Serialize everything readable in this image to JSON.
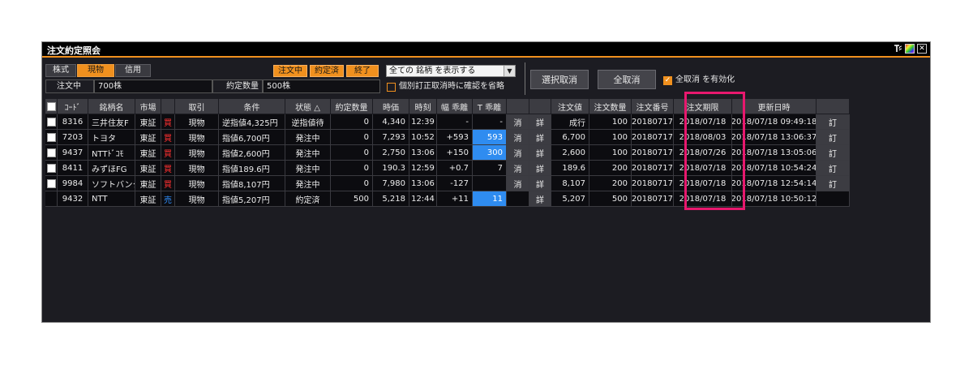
{
  "window": {
    "title": "注文約定照会",
    "icons": [
      "notification-icon",
      "color-theme-icon",
      "close-icon"
    ],
    "close_glyph": "✕"
  },
  "filters": {
    "product_tabs": [
      "株式",
      "現物",
      "信用"
    ],
    "product_selected": "現物",
    "status_chips": [
      "注文中",
      "約定済",
      "終了"
    ]
  },
  "summary": {
    "ordering_label": "注文中",
    "ordering_value": "700株",
    "executed_label": "約定数量",
    "executed_value": "500株"
  },
  "stock_filter": {
    "selected": "全ての 銘柄 を表示する"
  },
  "confirm_option": {
    "label": "個別訂正取消時に確認を省略",
    "checked": false
  },
  "actions": {
    "cancel_selected": "選択取消",
    "cancel_all": "全取消",
    "enable_cancel_all_label": "全取消 を有効化",
    "enable_cancel_all_checked": true
  },
  "table": {
    "columns": [
      "",
      "ｺｰﾄﾞ",
      "銘柄名",
      "市場",
      "",
      "取引",
      "条件",
      "状態 △",
      "約定数量",
      "時価",
      "時刻",
      "幅 乖離",
      "T 乖離",
      "",
      "",
      "注文値",
      "注文数量",
      "注文番号",
      "注文期限",
      "更新日時",
      ""
    ],
    "rows": [
      {
        "code": "8316",
        "name": "三井住友F",
        "market": "東証",
        "side": "買",
        "trade": "現物",
        "condition": "逆指値4,325円",
        "status": "逆指値待",
        "filled": "0",
        "price": "4,340",
        "time": "12:39",
        "spread": "-",
        "t_spread": "-",
        "cancel": "消",
        "detail": "詳",
        "order_price": "成行",
        "order_qty": "100",
        "order_no": "20180717",
        "expiry": "2018/07/18",
        "updated": "2018/07/18 09:49:18",
        "amend": "訂"
      },
      {
        "code": "7203",
        "name": "トヨタ",
        "market": "東証",
        "side": "買",
        "trade": "現物",
        "condition": "指値6,700円",
        "status": "発注中",
        "filled": "0",
        "price": "7,293",
        "time": "10:52",
        "spread": "+593",
        "t_spread": "593",
        "cancel": "消",
        "detail": "詳",
        "order_price": "6,700",
        "order_qty": "100",
        "order_no": "20180717",
        "expiry": "2018/08/03",
        "updated": "2018/07/18 13:06:37",
        "amend": "訂"
      },
      {
        "code": "9437",
        "name": "NTTﾄﾞｺﾓ",
        "market": "東証",
        "side": "買",
        "trade": "現物",
        "condition": "指値2,600円",
        "status": "発注中",
        "filled": "0",
        "price": "2,750",
        "time": "13:06",
        "spread": "+150",
        "t_spread": "300",
        "cancel": "消",
        "detail": "詳",
        "order_price": "2,600",
        "order_qty": "100",
        "order_no": "20180717",
        "expiry": "2018/07/26",
        "updated": "2018/07/18 13:05:06",
        "amend": "訂"
      },
      {
        "code": "8411",
        "name": "みずほFG",
        "market": "東証",
        "side": "買",
        "trade": "現物",
        "condition": "指値189.6円",
        "status": "発注中",
        "filled": "0",
        "price": "190.3",
        "time": "12:59",
        "spread": "+0.7",
        "t_spread": "7",
        "cancel": "消",
        "detail": "詳",
        "order_price": "189.6",
        "order_qty": "200",
        "order_no": "20180717",
        "expiry": "2018/07/18",
        "updated": "2018/07/18 10:54:24",
        "amend": "訂"
      },
      {
        "code": "9984",
        "name": "ソフトバンク",
        "market": "東証",
        "side": "買",
        "trade": "現物",
        "condition": "指値8,107円",
        "status": "発注中",
        "filled": "0",
        "price": "7,980",
        "time": "13:06",
        "spread": "-127",
        "t_spread": "",
        "cancel": "消",
        "detail": "詳",
        "order_price": "8,107",
        "order_qty": "200",
        "order_no": "20180717",
        "expiry": "2018/07/18",
        "updated": "2018/07/18 12:54:14",
        "amend": "訂"
      },
      {
        "code": "9432",
        "name": "NTT",
        "market": "東証",
        "side": "売",
        "trade": "現物",
        "condition": "指値5,207円",
        "status": "約定済",
        "filled": "500",
        "price": "5,218",
        "time": "12:44",
        "spread": "+11",
        "t_spread": "11",
        "cancel": "",
        "detail": "詳",
        "order_price": "5,207",
        "order_qty": "500",
        "order_no": "20180717",
        "expiry": "2018/07/18",
        "updated": "2018/07/18 10:50:12",
        "amend": ""
      }
    ]
  },
  "colors": {
    "accent": "#f0901e",
    "buy": "#ff3030",
    "sell": "#3090ff",
    "highlight_cell": "#2f8cf0",
    "annotation": "#e8186e"
  }
}
